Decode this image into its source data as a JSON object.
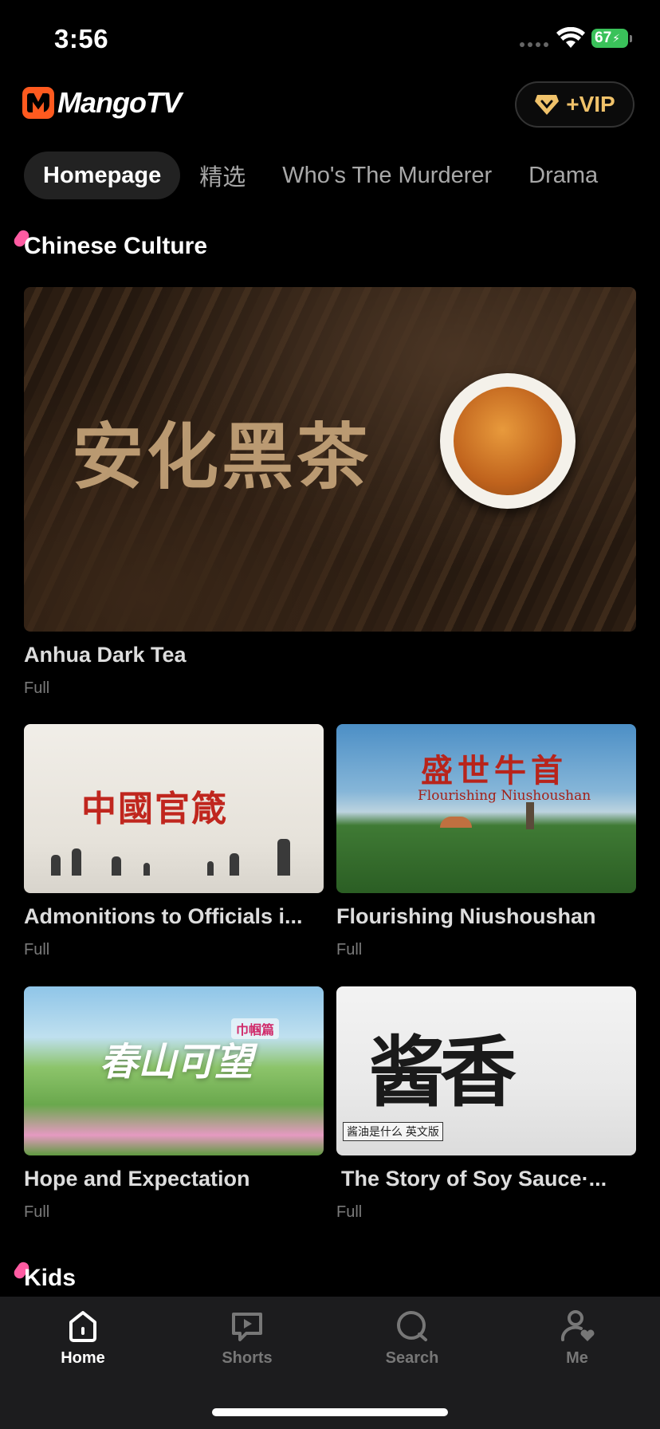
{
  "status_bar": {
    "time": "3:56",
    "battery": "67"
  },
  "header": {
    "logo_text": "MangoTV",
    "vip_label": "+VIP"
  },
  "tabs": [
    {
      "label": "Homepage",
      "active": true
    },
    {
      "label": "精选"
    },
    {
      "label": "Who's The Murderer"
    },
    {
      "label": "Drama"
    }
  ],
  "sections": [
    {
      "title": "Chinese Culture",
      "items": [
        {
          "title": "Anhua Dark Tea",
          "sub": "Full",
          "art_text": "安化黑茶"
        },
        {
          "title": "Admonitions to Officials i...",
          "sub": "Full",
          "art_text": "中國官箴"
        },
        {
          "title": "Flourishing Niushoushan",
          "sub": "Full",
          "art_text": "盛世牛首",
          "art_subtext": "Flourishing  Niushoushan"
        },
        {
          "title": "Hope and Expectation",
          "sub": "Full",
          "art_text": "春山可望",
          "art_badge": "巾帼篇"
        },
        {
          "title": "The Story of Soy Sauce·...",
          "sub": "Full",
          "art_text": "酱香",
          "art_badge": "酱油是什么 英文版"
        }
      ]
    },
    {
      "title": "Kids"
    }
  ],
  "bottom_nav": [
    {
      "label": "Home",
      "icon": "home-icon",
      "active": true
    },
    {
      "label": "Shorts",
      "icon": "play-icon"
    },
    {
      "label": "Search",
      "icon": "search-icon"
    },
    {
      "label": "Me",
      "icon": "profile-icon"
    }
  ],
  "colors": {
    "brand": "#ff5a1f",
    "vip_gold": "#f0c26a",
    "section_dot": "#ff5ba2",
    "active_tab_bg": "#222222"
  }
}
